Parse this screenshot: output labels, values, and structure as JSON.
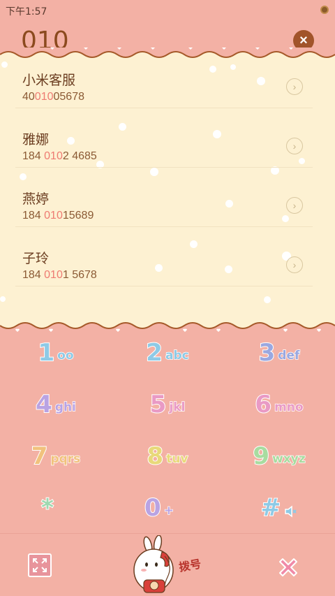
{
  "status_bar": {
    "time": "下午1:57"
  },
  "dialer": {
    "input_value": "010",
    "clear_label": "×"
  },
  "contacts": [
    {
      "name": "小米客服",
      "number_pre": "40",
      "number_match": "010",
      "number_post": "05678"
    },
    {
      "name": "雅娜",
      "number_pre": "184 ",
      "number_match": "010",
      "number_post": "2 4685"
    },
    {
      "name": "燕婷",
      "number_pre": "184 ",
      "number_match": "010",
      "number_post": "15689"
    },
    {
      "name": "子玲",
      "number_pre": "184 ",
      "number_match": "010",
      "number_post": "1 5678"
    }
  ],
  "keypad": [
    {
      "digit": "1",
      "letters": "oo",
      "color": "#8ecae6"
    },
    {
      "digit": "2",
      "letters": "abc",
      "color": "#8ecae6"
    },
    {
      "digit": "3",
      "letters": "def",
      "color": "#9aa8e0"
    },
    {
      "digit": "4",
      "letters": "ghi",
      "color": "#b9a3e3"
    },
    {
      "digit": "5",
      "letters": "jkl",
      "color": "#e99ac5"
    },
    {
      "digit": "6",
      "letters": "mno",
      "color": "#e99ac5"
    },
    {
      "digit": "7",
      "letters": "pqrs",
      "color": "#f1c27d"
    },
    {
      "digit": "8",
      "letters": "tuv",
      "color": "#e8d97a"
    },
    {
      "digit": "9",
      "letters": "wxyz",
      "color": "#a8dca0"
    },
    {
      "digit": "*",
      "letters": "",
      "color": "#9ed8b0"
    },
    {
      "digit": "0",
      "letters": "+",
      "color": "#b9a3e3"
    },
    {
      "digit": "#",
      "letters": "",
      "color": "#8ecae6"
    }
  ],
  "bottom_bar": {
    "dial_label": "拨号"
  },
  "colors": {
    "background_pink": "#f3b1a5",
    "panel_cream": "#fdf1d2",
    "wave_brown": "#a65a2a",
    "match_highlight": "#ee7b72"
  }
}
